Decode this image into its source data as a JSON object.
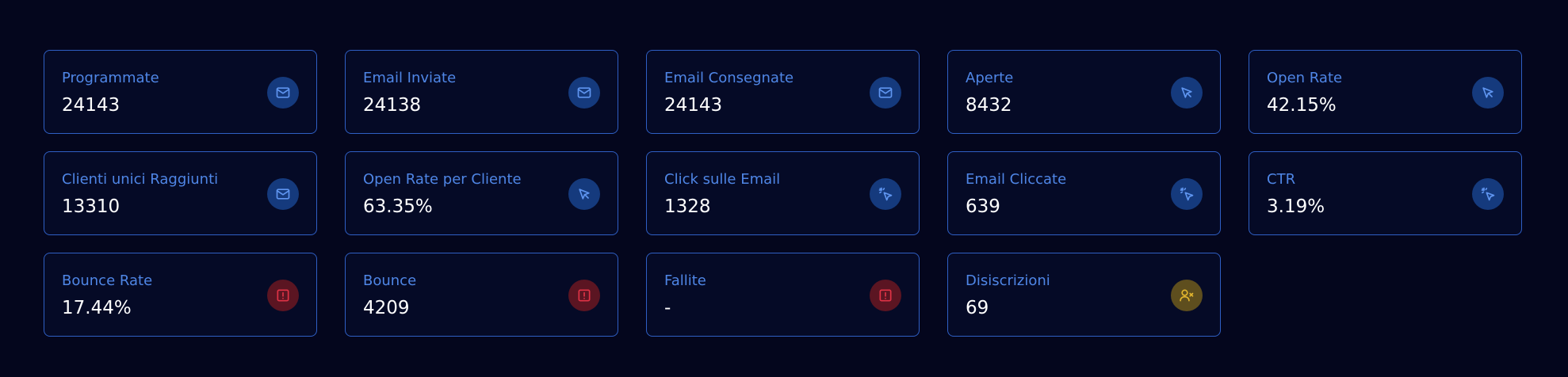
{
  "colors": {
    "background": "#04061d",
    "card_border": "#2f5fc4",
    "label": "#4f86e6",
    "value": "#ffffff",
    "icon_blue_bg": "#153a7d",
    "icon_red_bg": "#5b1522",
    "icon_yellow_bg": "#5e4e1e"
  },
  "cards": [
    {
      "label": "Programmate",
      "value": "24143",
      "icon": "envelope-icon"
    },
    {
      "label": "Email Inviate",
      "value": "24138",
      "icon": "envelope-icon"
    },
    {
      "label": "Email Consegnate",
      "value": "24143",
      "icon": "envelope-icon"
    },
    {
      "label": "Aperte",
      "value": "8432",
      "icon": "cursor-pointer-icon"
    },
    {
      "label": "Open Rate",
      "value": "42.15%",
      "icon": "cursor-pointer-icon"
    },
    {
      "label": "Clienti unici Raggiunti",
      "value": "13310",
      "icon": "envelope-icon"
    },
    {
      "label": "Open Rate per Cliente",
      "value": "63.35%",
      "icon": "cursor-pointer-icon"
    },
    {
      "label": "Click sulle Email",
      "value": "1328",
      "icon": "cursor-click-icon"
    },
    {
      "label": "Email Cliccate",
      "value": "639",
      "icon": "cursor-click-icon"
    },
    {
      "label": "CTR",
      "value": "3.19%",
      "icon": "cursor-click-icon"
    },
    {
      "label": "Bounce Rate",
      "value": "17.44%",
      "icon": "alert-square-icon"
    },
    {
      "label": "Bounce",
      "value": "4209",
      "icon": "alert-square-icon"
    },
    {
      "label": "Fallite",
      "value": "-",
      "icon": "alert-square-icon"
    },
    {
      "label": "Disiscrizioni",
      "value": "69",
      "icon": "user-remove-icon"
    }
  ]
}
